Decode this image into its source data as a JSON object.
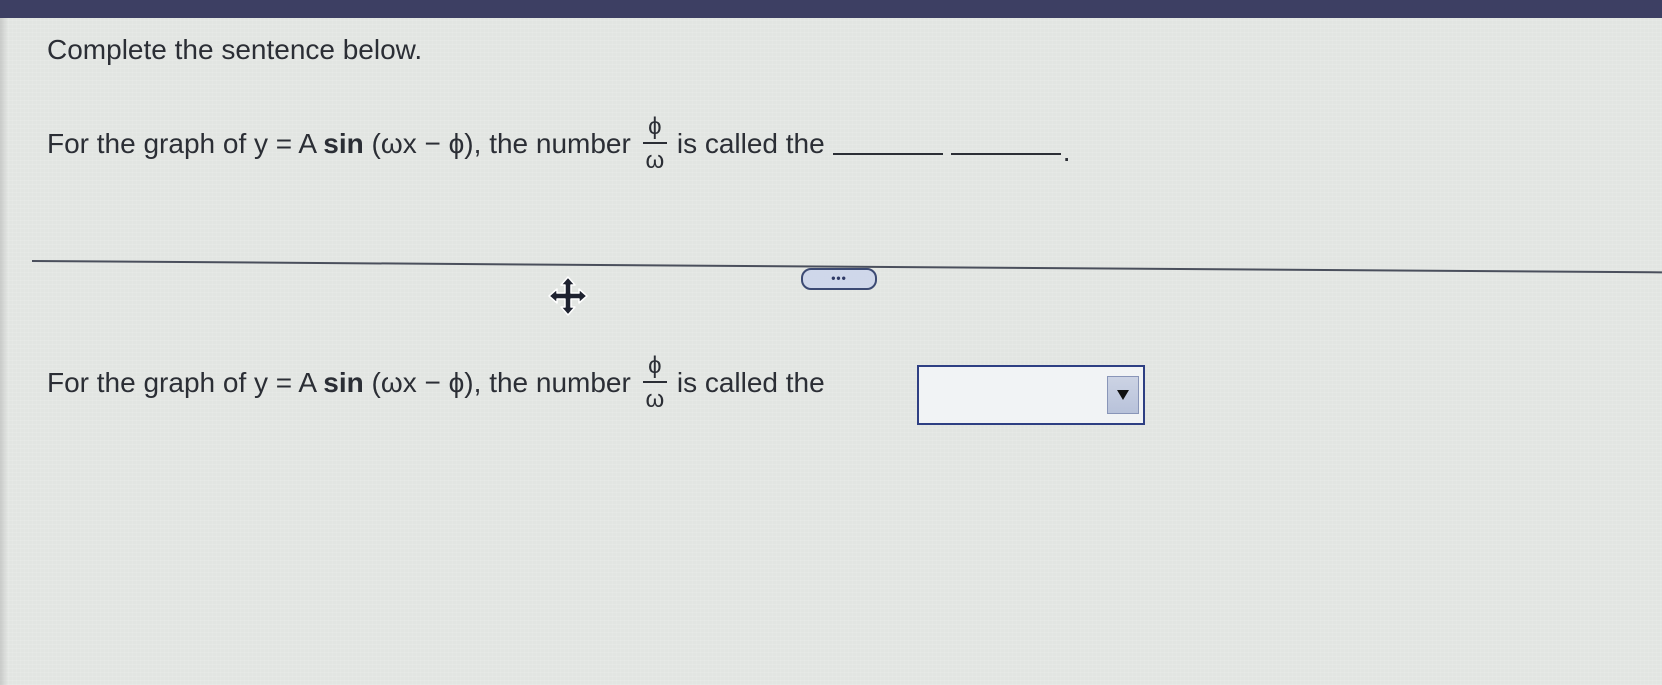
{
  "question": {
    "instruction": "Complete the sentence below.",
    "sentence": {
      "prefix": "For the graph of y = A ",
      "sin": "sin",
      "argument": " (ωx − ϕ), the number",
      "fraction_numerator": "ϕ",
      "fraction_denominator": "ω",
      "suffix": "is called the",
      "end_period": "."
    }
  },
  "more_button": {
    "label": "•••"
  },
  "answer": {
    "prefix": "For the graph of y = A ",
    "sin": "sin",
    "argument": " (ωx − ϕ), the number",
    "fraction_numerator": "ϕ",
    "fraction_denominator": "ω",
    "suffix": "is called the",
    "dropdown_value": ""
  },
  "icons": {
    "move_cursor": "move-cursor-icon",
    "dropdown_arrow": "triangle-down-icon"
  },
  "colors": {
    "top_bar": "#3d3f63",
    "background": "#e2e5e2",
    "dropdown_border": "#2e3f83",
    "more_button_border": "#3c4a73"
  }
}
